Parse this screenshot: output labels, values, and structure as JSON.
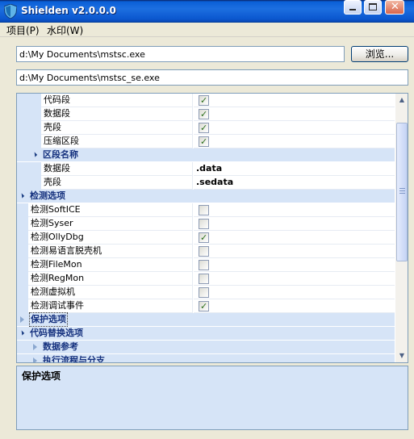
{
  "window": {
    "title": "Shielden v2.0.0.0",
    "controls": {
      "minimize": "minimize",
      "maximize": "maximize",
      "close": "close"
    }
  },
  "menu": [
    {
      "label": "项目(P)"
    },
    {
      "label": "水印(W)"
    }
  ],
  "paths": {
    "input": "d:\\My Documents\\mstsc.exe",
    "output": "d:\\My Documents\\mstsc_se.exe",
    "browse_label": "浏览..."
  },
  "grid": {
    "rows": [
      {
        "type": "prop",
        "indent": true,
        "name": "代码段",
        "kind": "check",
        "checked": true
      },
      {
        "type": "prop",
        "indent": true,
        "name": "数据段",
        "kind": "check",
        "checked": true
      },
      {
        "type": "prop",
        "indent": true,
        "name": "壳段",
        "kind": "check",
        "checked": true
      },
      {
        "type": "prop",
        "indent": true,
        "name": "压缩区段",
        "kind": "check",
        "checked": true
      },
      {
        "type": "category",
        "sub": true,
        "expanded": true,
        "label": "区段名称"
      },
      {
        "type": "prop",
        "indent": true,
        "name": "数据段",
        "kind": "text",
        "value": ".data"
      },
      {
        "type": "prop",
        "indent": true,
        "name": "壳段",
        "kind": "text",
        "value": ".sedata"
      },
      {
        "type": "category",
        "sub": false,
        "expanded": true,
        "label": "检测选项"
      },
      {
        "type": "prop",
        "indent": false,
        "name": "检测SoftICE",
        "kind": "check",
        "checked": false
      },
      {
        "type": "prop",
        "indent": false,
        "name": "检测Syser",
        "kind": "check",
        "checked": false
      },
      {
        "type": "prop",
        "indent": false,
        "name": "检测OllyDbg",
        "kind": "check",
        "checked": true
      },
      {
        "type": "prop",
        "indent": false,
        "name": "检测易语言脱壳机",
        "kind": "check",
        "checked": false
      },
      {
        "type": "prop",
        "indent": false,
        "name": "检测FileMon",
        "kind": "check",
        "checked": false
      },
      {
        "type": "prop",
        "indent": false,
        "name": "检测RegMon",
        "kind": "check",
        "checked": false
      },
      {
        "type": "prop",
        "indent": false,
        "name": "检测虚拟机",
        "kind": "check",
        "checked": false
      },
      {
        "type": "prop",
        "indent": false,
        "name": "检测调试事件",
        "kind": "check",
        "checked": true
      },
      {
        "type": "category",
        "sub": false,
        "expanded": false,
        "selected": true,
        "label": "保护选项"
      },
      {
        "type": "category",
        "sub": false,
        "expanded": true,
        "label": "代码替换选项"
      },
      {
        "type": "category",
        "sub": true,
        "expanded": false,
        "label": "数据参考"
      },
      {
        "type": "category",
        "sub": true,
        "expanded": false,
        "label": "执行流程与分支"
      }
    ],
    "scroll_fraction": 0.52
  },
  "description": {
    "title": "保护选项"
  },
  "colors": {
    "titlebar": "#0b58d0",
    "category_bg": "#d6e4f7",
    "category_text": "#15317e",
    "check_tick": "#2b6d1a"
  }
}
